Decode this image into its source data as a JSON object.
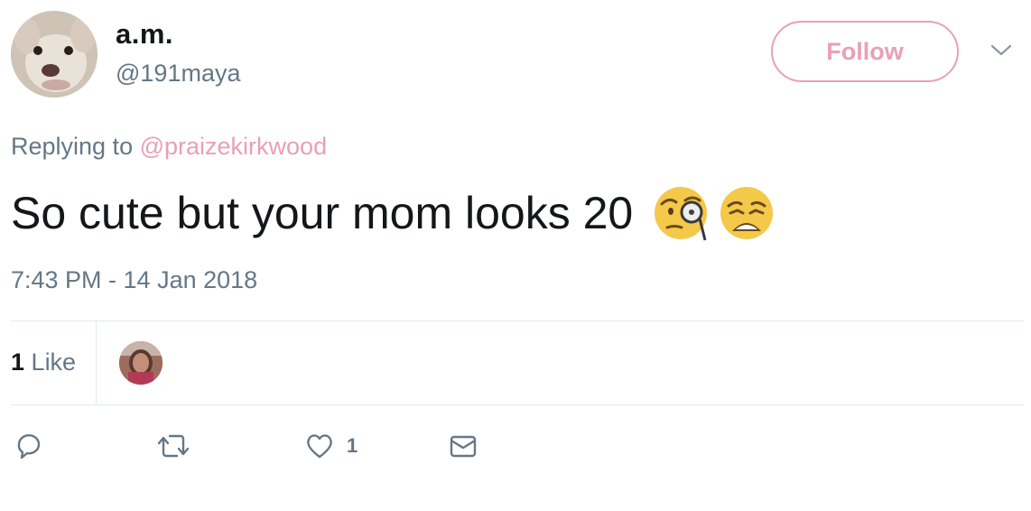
{
  "tweet": {
    "author_name": "a.m.",
    "author_handle": "@191maya",
    "follow_label": "Follow",
    "replying_prefix": "Replying to",
    "replying_to": "@praizekirkwood",
    "text": "So cute but your mom looks 20",
    "emojis": [
      "face-with-monocle-emoji",
      "weary-face-emoji"
    ],
    "timestamp": "7:43 PM - 14 Jan 2018",
    "likes_count": "1",
    "likes_label": "Like",
    "like_action_count": "1"
  },
  "colors": {
    "accent": "#e8a0b6",
    "secondary_text": "#657786",
    "primary_text": "#14171a",
    "divider": "#e1e8ed"
  },
  "icons": [
    "reply-icon",
    "retweet-icon",
    "heart-icon",
    "direct-message-icon",
    "chevron-down-icon"
  ]
}
